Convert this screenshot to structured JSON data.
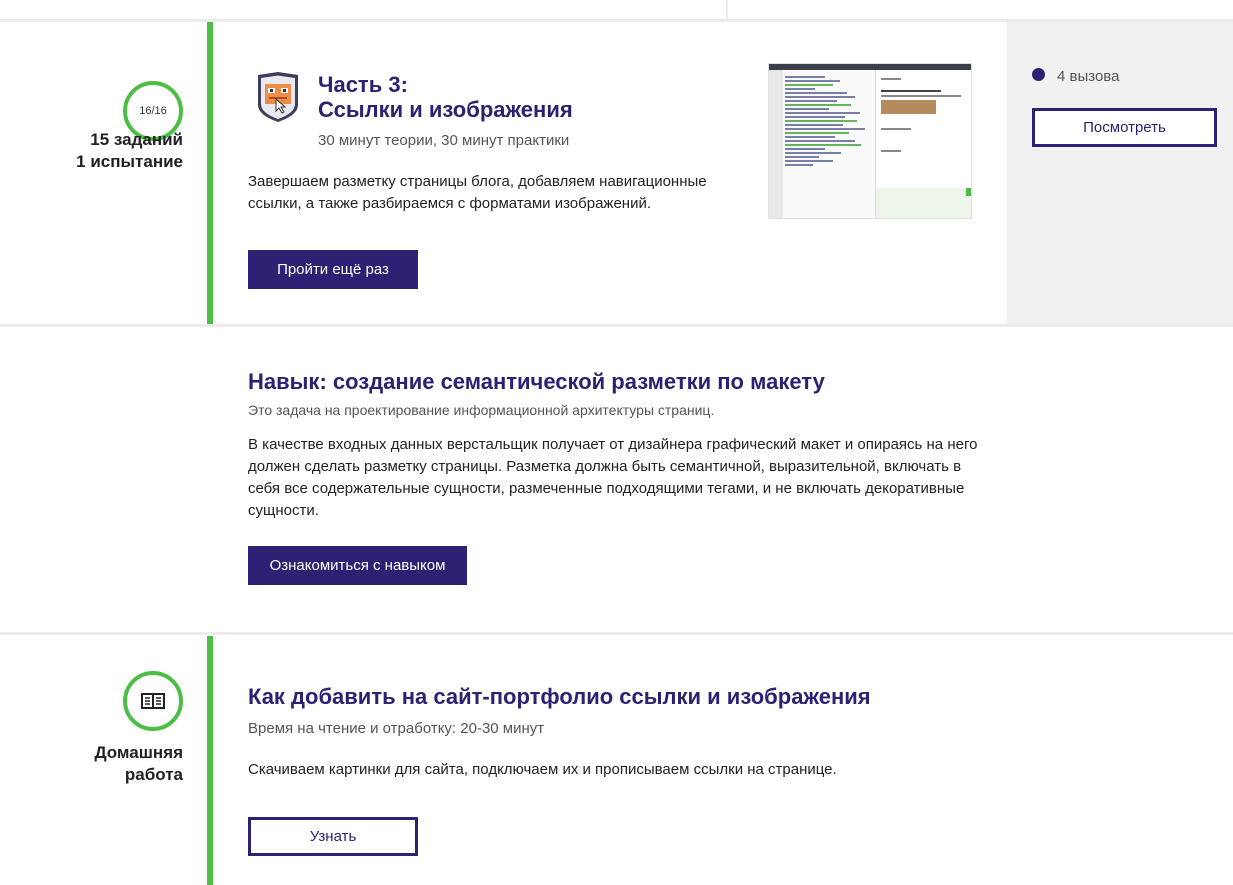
{
  "colors": {
    "accent": "#2d2173",
    "timeline": "#4cbd45",
    "panel": "#f1f1f1"
  },
  "part": {
    "progress": "16/16",
    "meta_line1": "15 заданий",
    "meta_line2": "1 испытание",
    "icon": "shield-badge-icon",
    "title_line1": "Часть 3:",
    "title_line2": "Ссылки и изображения",
    "subtitle": "30 минут теории, 30 минут практики",
    "description": "Завершаем разметку страницы блога, добавляем навигационные ссылки, а также разбираемся с форматами изображений.",
    "button_label": "Пройти ещё раз",
    "calls_label": "4 вызова",
    "view_button_label": "Посмотреть"
  },
  "skill": {
    "title": "Навык: создание семантической разметки по макету",
    "subtitle": "Это задача на проектирование информационной архитектуры страниц.",
    "description": "В качестве входных данных верстальщик получает от дизайнера графический макет и опираясь на него должен сделать разметку страницы. Разметка должна быть семантичной, выразительной, включать в себя все содержательные сущности, размеченные подходящими тегами, и не включать декоративные сущности.",
    "button_label": "Ознакомиться с навыком"
  },
  "homework": {
    "icon": "book-icon",
    "label_line1": "Домашняя",
    "label_line2": "работа",
    "title": "Как добавить на сайт-портфолио ссылки и изображения",
    "subtitle": "Время на чтение и отработку: 20-30 минут",
    "description": "Скачиваем картинки для сайта, подключаем их и прописываем ссылки на странице.",
    "button_label": "Узнать"
  }
}
